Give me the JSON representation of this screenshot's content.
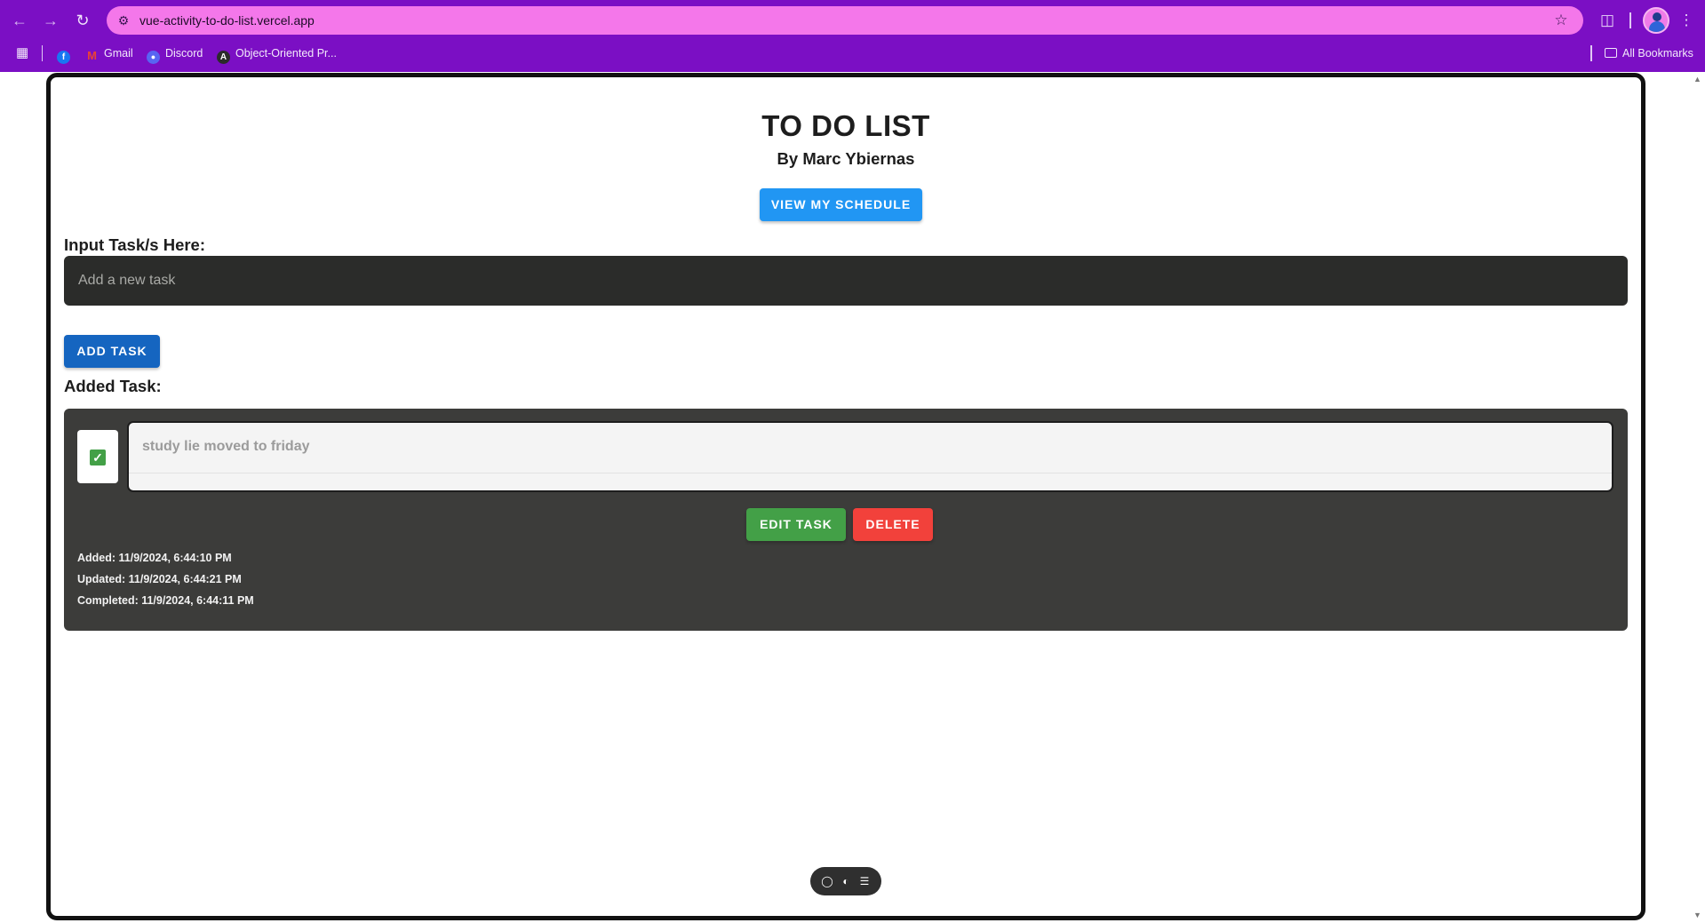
{
  "browser": {
    "url": "vue-activity-to-do-list.vercel.app",
    "bookmarks": [
      {
        "label": "",
        "icon": "facebook-icon",
        "color": "#1877f2"
      },
      {
        "label": "Gmail",
        "icon": "gmail-icon",
        "color": "#ea4335"
      },
      {
        "label": "Discord",
        "icon": "discord-icon",
        "color": "#5865f2"
      },
      {
        "label": "Object-Oriented Pr...",
        "icon": "angular-icon",
        "color": "#2b2b2b"
      }
    ],
    "all_bookmarks": "All Bookmarks"
  },
  "page": {
    "title": "TO DO LIST",
    "subtitle": "By Marc Ybiernas",
    "schedule_button": "VIEW MY SCHEDULE",
    "input_label": "Input Task/s Here:",
    "input_placeholder": "Add a new task",
    "add_button": "ADD TASK",
    "added_label": "Added Task:",
    "tasks": [
      {
        "text": "study lie moved to friday",
        "completed": true,
        "edit_label": "EDIT TASK",
        "delete_label": "DELETE",
        "added": "Added: 11/9/2024, 6:44:10 PM",
        "updated": "Updated: 11/9/2024, 6:44:21 PM",
        "completed_at": "Completed: 11/9/2024, 6:44:11 PM"
      }
    ]
  },
  "colors": {
    "chrome": "#7b0fc4",
    "omnibox": "#f477ea",
    "primary": "#2196f3",
    "add": "#1565c0",
    "edit": "#43a047",
    "delete": "#f2413b",
    "card": "#3c3c3a",
    "input": "#2b2c2a"
  }
}
